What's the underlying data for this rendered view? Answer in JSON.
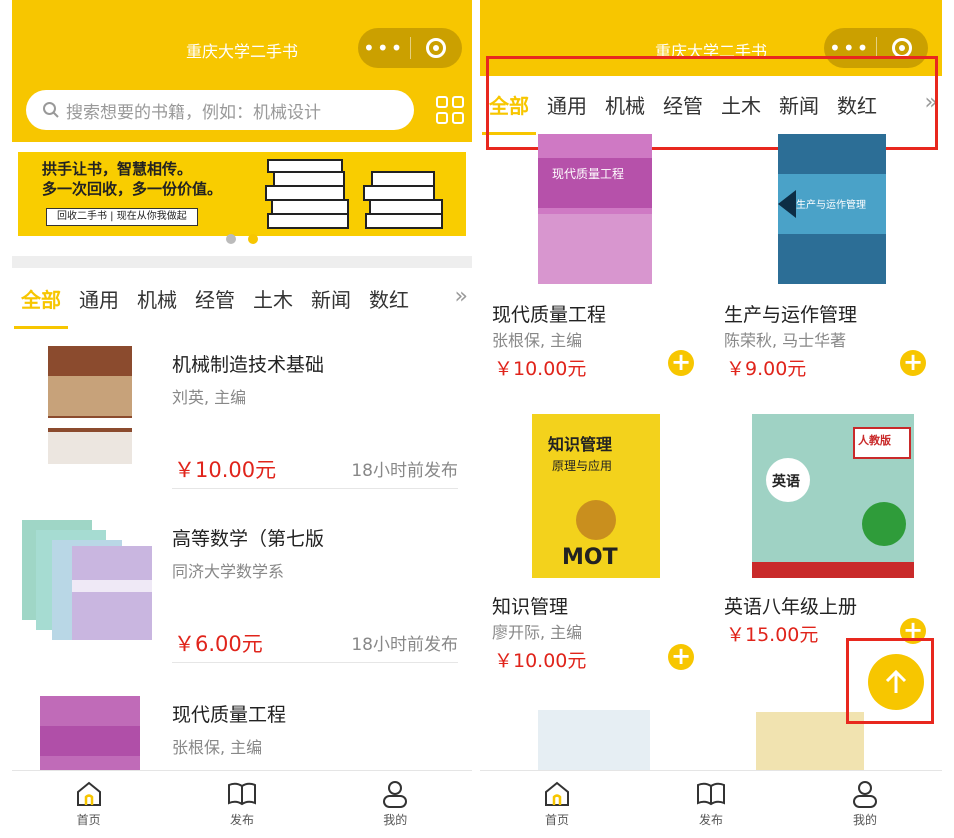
{
  "app": {
    "title": "重庆大学二手书"
  },
  "search": {
    "placeholder": "搜索想要的书籍，例如：机械设计"
  },
  "banner": {
    "line1": "拱手让书，智慧相传。",
    "line2": "多一次回收，多一份价值。",
    "tag": "回收二手书 | 现在从你我做起"
  },
  "tabs": [
    "全部",
    "通用",
    "机械",
    "经管",
    "土木",
    "新闻",
    "数红"
  ],
  "tabs_right": [
    "全部",
    "通用",
    "机械",
    "经管",
    "土木",
    "新闻",
    "数红"
  ],
  "list": [
    {
      "title": "机械制造技术基础",
      "author": "刘英, 主编",
      "price": "￥10.00元",
      "time": "18小时前发布"
    },
    {
      "title": "高等数学（第七版",
      "author": "同济大学数学系",
      "price": "￥6.00元",
      "time": "18小时前发布"
    },
    {
      "title": "现代质量工程",
      "author": "张根保, 主编"
    }
  ],
  "grid": [
    {
      "title": "现代质量工程",
      "author": "张根保, 主编",
      "price": "￥10.00元",
      "cover_text": "现代质量工程"
    },
    {
      "title": "生产与运作管理",
      "author": "陈荣秋, 马士华著",
      "price": "￥9.00元",
      "cover_text": "生产与运作管理"
    },
    {
      "title": "知识管理",
      "author": "廖开际, 主编",
      "price": "￥10.00元",
      "cover_text": "知识管理",
      "cover_sub": "原理与应用",
      "cover_brand": "MOT"
    },
    {
      "title": "英语八年级上册",
      "author": "",
      "price": "￥15.00元",
      "cover_text": "英语",
      "cover_badge": "人教版"
    }
  ],
  "tabbar": [
    {
      "label": "首页"
    },
    {
      "label": "发布"
    },
    {
      "label": "我的"
    }
  ],
  "colors": {
    "brand": "#f7c600",
    "price": "#e0241b",
    "highlight": "#e8281e"
  },
  "icons": [
    "search-icon",
    "grid-icon",
    "more-icon",
    "target-icon",
    "chevron-right-icon",
    "home-icon",
    "book-icon",
    "user-icon",
    "plus-icon",
    "arrow-up-icon"
  ]
}
